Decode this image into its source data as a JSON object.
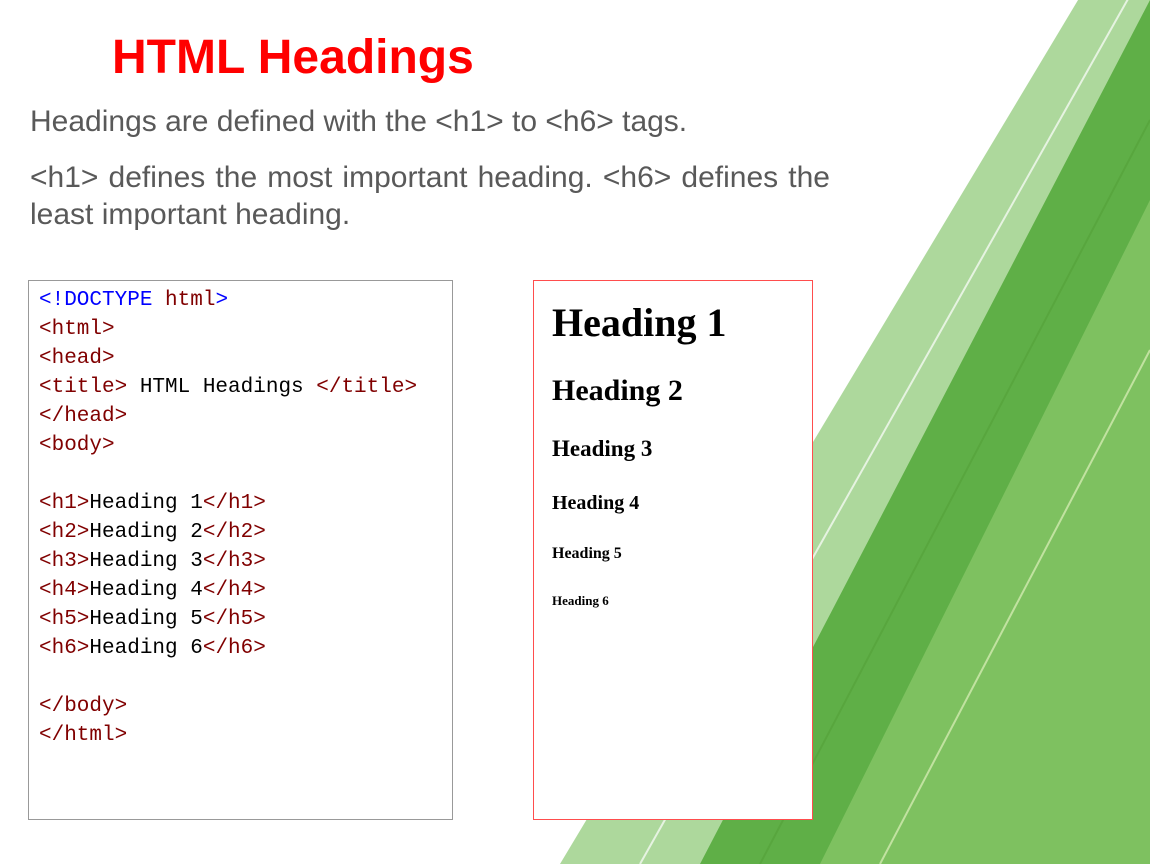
{
  "title": "HTML Headings",
  "paragraph1": "Headings are defined with the <h1> to <h6> tags.",
  "paragraph2": "<h1> defines the most important heading. <h6> defines the least important heading.",
  "code": {
    "doctype_open": "<!DOCTYPE",
    "doctype_text": " html",
    "doctype_close": ">",
    "html_open": "<html>",
    "head_open": "<head>",
    "title_open": "<title>",
    "title_text": " HTML Headings ",
    "title_close": "</title>",
    "head_close": "</head>",
    "body_open": "<body>",
    "h1_open": "<h1>",
    "h1_text": "Heading 1",
    "h1_close": "</h1>",
    "h2_open": "<h2>",
    "h2_text": "Heading 2",
    "h2_close": "</h2>",
    "h3_open": "<h3>",
    "h3_text": "Heading 3",
    "h3_close": "</h3>",
    "h4_open": "<h4>",
    "h4_text": "Heading 4",
    "h4_close": "</h4>",
    "h5_open": "<h5>",
    "h5_text": "Heading 5",
    "h5_close": "</h5>",
    "h6_open": "<h6>",
    "h6_text": "Heading 6",
    "h6_close": "</h6>",
    "body_close": "</body>",
    "html_close": "</html>"
  },
  "output": {
    "h1": "Heading 1",
    "h2": "Heading 2",
    "h3": "Heading 3",
    "h4": "Heading 4",
    "h5": "Heading 5",
    "h6": "Heading 6"
  }
}
